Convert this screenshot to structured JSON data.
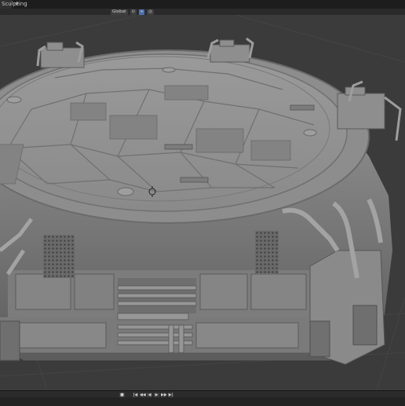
{
  "tab": {
    "label": "Sculpting",
    "add": "+"
  },
  "header": {
    "transform_orientation": "Global",
    "pivot_icon": "pivot-icon",
    "snap_icon": "snap-icon",
    "proportional_icon": "proportional-editing-icon"
  },
  "timeline": {
    "buttons": [
      "■",
      "|◀",
      "◀◀",
      "◀",
      "▶",
      "▶▶",
      "▶|"
    ]
  },
  "colors": {
    "viewport_bg": "#3b3b3b",
    "header_bg": "#1d1d1d",
    "model_base": "#8f8f8f",
    "accent": "#4772b3"
  }
}
